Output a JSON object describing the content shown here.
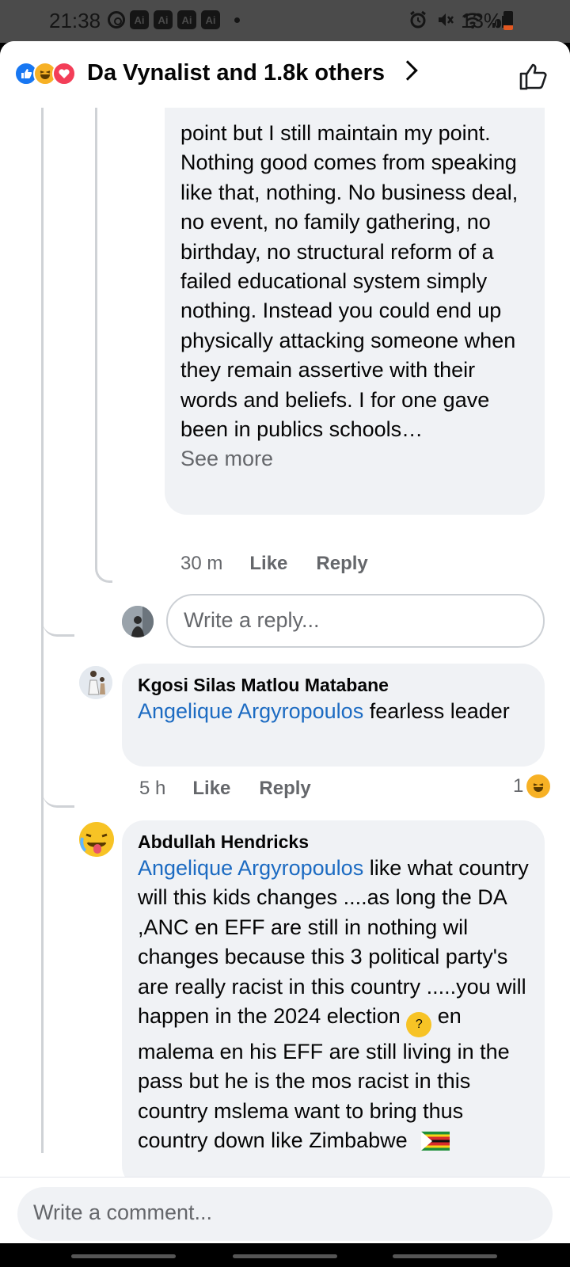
{
  "status_bar": {
    "time": "21:38",
    "ai_badges": [
      "Ai",
      "Ai",
      "Ai",
      "Ai"
    ],
    "battery": "13%",
    "icons": [
      "sync-icon",
      "alarm-icon",
      "mute-icon",
      "wifi-icon",
      "signal-icon",
      "battery-icon"
    ]
  },
  "header": {
    "title": "Da Vynalist and 1.8k others",
    "reaction_icons": [
      "like-reaction-icon",
      "haha-reaction-icon",
      "love-reaction-icon"
    ]
  },
  "comments": [
    {
      "text": "point but I still maintain my point. Nothing good comes from speaking like that, nothing. No business deal, no event, no family gathering, no birthday, no structural reform of a failed educational system simply nothing. Instead you could end up physically attacking someone when they remain assertive with their words and beliefs. I for one gave been in publics schools…",
      "see_more": "See more",
      "time": "30 m",
      "like": "Like",
      "reply": "Reply"
    },
    {
      "author": "Kgosi Silas Matlou Matabane",
      "mention": "Angelique Argyropoulos",
      "text": " fearless leader",
      "time": "5 h",
      "like": "Like",
      "reply": "Reply",
      "reaction_count": "1"
    },
    {
      "author": "Abdullah Hendricks",
      "mention": "Angelique Argyropoulos",
      "text_1": " like what country will this kids changes ....as long the DA ,ANC en EFF are still in nothing wil changes because  this 3 political party's are really racist  in this country .....you will happen in the 2024 election ",
      "text_2": "  en malema en his EFF are still living in the pass but he is the mos racist  in this country mslema want to bring thus country down like Zimbabwe "
    }
  ],
  "reply_box": {
    "placeholder": "Write a reply..."
  },
  "comment_box": {
    "placeholder": "Write a comment..."
  }
}
